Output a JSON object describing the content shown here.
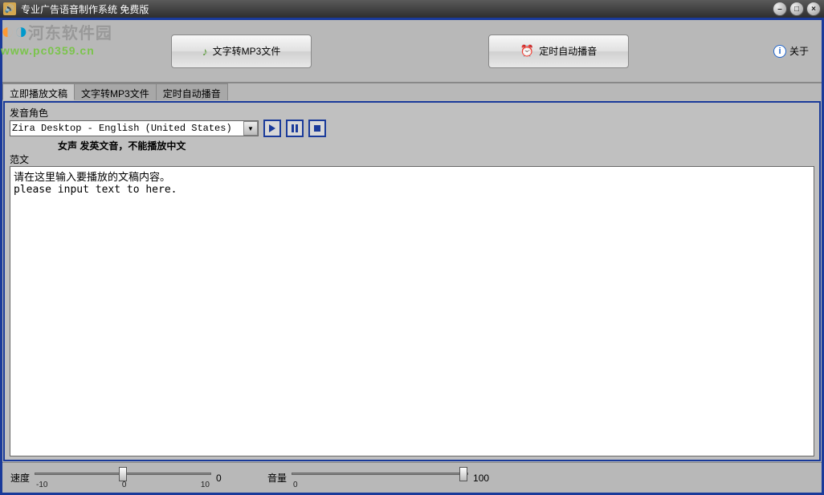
{
  "titlebar": {
    "title": "专业广告语音制作系统 免费版"
  },
  "watermark": {
    "brand_cn": "河东软件园",
    "url": "www.pc0359.cn"
  },
  "toolbar": {
    "btn_mp3": "文字转MP3文件",
    "btn_timer": "定时自动播音",
    "about": "关于"
  },
  "tabs": [
    {
      "label": "立即播放文稿",
      "active": true
    },
    {
      "label": "文字转MP3文件",
      "active": false
    },
    {
      "label": "定时自动播音",
      "active": false
    }
  ],
  "voice": {
    "label": "发音角色",
    "selected": "Zira Desktop - English (United States)",
    "desc": "女声   发英文音，不能播放中文"
  },
  "content": {
    "sample_label": "范文",
    "text": "请在这里输入要播放的文稿内容。\nplease input text to here."
  },
  "sliders": {
    "speed": {
      "label": "速度",
      "value": 0,
      "min": -10,
      "max": 10,
      "min_tick": "-10",
      "max_tick": "10",
      "mid_tick": "0"
    },
    "volume": {
      "label": "音量",
      "value": 100,
      "min": 0,
      "max": 100,
      "min_tick": "0"
    }
  }
}
